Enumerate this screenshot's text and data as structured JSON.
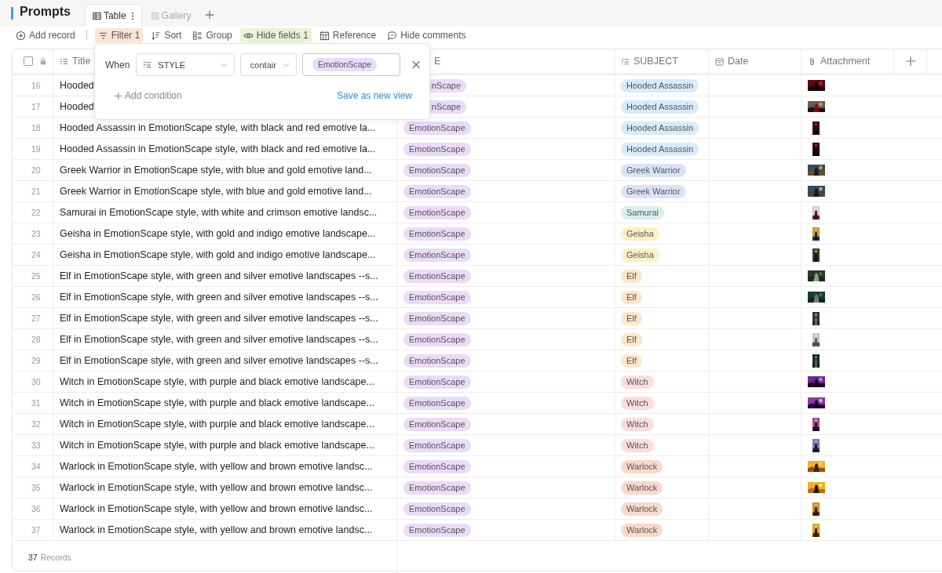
{
  "page": {
    "title": "Prompts"
  },
  "view_tabs": [
    {
      "label": "Table",
      "kind": "table",
      "selected": true
    },
    {
      "label": "Gallery",
      "kind": "gallery",
      "selected": false
    }
  ],
  "toolbar": [
    {
      "label": "Add record",
      "kind": "add",
      "active": false
    },
    {
      "label": "Filter 1",
      "kind": "filter",
      "active": true,
      "color": "#fce4d6"
    },
    {
      "label": "Sort",
      "kind": "sort",
      "active": false
    },
    {
      "label": "Group",
      "kind": "group",
      "active": false
    },
    {
      "label": "Hide fields 1",
      "kind": "eye",
      "active": true,
      "color": "#e8f4d4"
    },
    {
      "label": "Reference",
      "kind": "reference",
      "active": false
    },
    {
      "label": "Hide comments",
      "kind": "comment",
      "active": false
    }
  ],
  "filter_popover": {
    "when": "When",
    "field": "STYLE",
    "operator": "contair",
    "value": "EmotionScape",
    "add_condition": "Add condition",
    "save": "Save as new view"
  },
  "table": {
    "select_all": {
      "checked": false
    },
    "columns": [
      {
        "label": "Title",
        "kind": "text"
      },
      {
        "label": "E",
        "kind": "select"
      },
      {
        "label": "SUBJECT",
        "kind": "select"
      },
      {
        "label": "Date",
        "kind": "date"
      },
      {
        "label": "Attachment",
        "kind": "attachment"
      }
    ],
    "rows": [
      {
        "number": "16",
        "title": "Hooded",
        "style": "nScape",
        "subject": {
          "label": "Hooded Assassin",
          "color": "#d6ebfb"
        }
      },
      {
        "number": "17",
        "title": "Hooded",
        "style": "nScape",
        "subject": {
          "label": "Hooded Assassin",
          "color": "#d6ebfb"
        }
      },
      {
        "number": "18",
        "title": "Hooded Assassin in EmotionScape style, with black and red emotive la...",
        "style": "EmotionScape",
        "subject": {
          "label": "Hooded Assassin",
          "color": "#d6ebfb"
        }
      },
      {
        "number": "19",
        "title": "Hooded Assassin in EmotionScape style, with black and red emotive la...",
        "style": "EmotionScape",
        "subject": {
          "label": "Hooded Assassin",
          "color": "#d6ebfb"
        }
      },
      {
        "number": "20",
        "title": "Greek Warrior in EmotionScape style, with blue and gold emotive land...",
        "style": "EmotionScape",
        "subject": {
          "label": "Greek Warrior",
          "color": "#d9e3f8"
        }
      },
      {
        "number": "21",
        "title": "Greek Warrior in EmotionScape style, with blue and gold emotive land...",
        "style": "EmotionScape",
        "subject": {
          "label": "Greek Warrior",
          "color": "#d9e3f8"
        }
      },
      {
        "number": "22",
        "title": "Samurai in EmotionScape style, with white and crimson emotive landsc...",
        "style": "EmotionScape",
        "subject": {
          "label": "Samurai",
          "color": "#d6f1ee"
        }
      },
      {
        "number": "23",
        "title": "Geisha in EmotionScape style, with gold and indigo emotive landscape...",
        "style": "EmotionScape",
        "subject": {
          "label": "Geisha",
          "color": "#fdf0c2"
        }
      },
      {
        "number": "24",
        "title": "Geisha in EmotionScape style, with gold and indigo emotive landscape...",
        "style": "EmotionScape",
        "subject": {
          "label": "Geisha",
          "color": "#fdf0c2"
        }
      },
      {
        "number": "25",
        "title": "Elf in EmotionScape style, with green and silver emotive landscapes --s...",
        "style": "EmotionScape",
        "subject": {
          "label": "Elf",
          "color": "#fde6c6"
        }
      },
      {
        "number": "26",
        "title": "Elf in EmotionScape style, with green and silver emotive landscapes --s...",
        "style": "EmotionScape",
        "subject": {
          "label": "Elf",
          "color": "#fde6c6"
        }
      },
      {
        "number": "27",
        "title": "Elf in EmotionScape style, with green and silver emotive landscapes --s...",
        "style": "EmotionScape",
        "subject": {
          "label": "Elf",
          "color": "#fde6c6"
        }
      },
      {
        "number": "28",
        "title": "Elf in EmotionScape style, with green and silver emotive landscapes --s...",
        "style": "EmotionScape",
        "subject": {
          "label": "Elf",
          "color": "#fde6c6"
        }
      },
      {
        "number": "29",
        "title": "Elf in EmotionScape style, with green and silver emotive landscapes --s...",
        "style": "EmotionScape",
        "subject": {
          "label": "Elf",
          "color": "#fde6c6"
        }
      },
      {
        "number": "30",
        "title": "Witch in EmotionScape style, with purple and black emotive landscape...",
        "style": "EmotionScape",
        "subject": {
          "label": "Witch",
          "color": "#fbdddd"
        }
      },
      {
        "number": "31",
        "title": "Witch in EmotionScape style, with purple and black emotive landscape...",
        "style": "EmotionScape",
        "subject": {
          "label": "Witch",
          "color": "#fbdddd"
        }
      },
      {
        "number": "32",
        "title": "Witch in EmotionScape style, with purple and black emotive landscape...",
        "style": "EmotionScape",
        "subject": {
          "label": "Witch",
          "color": "#fbdddd"
        }
      },
      {
        "number": "33",
        "title": "Witch in EmotionScape style, with purple and black emotive landscape...",
        "style": "EmotionScape",
        "subject": {
          "label": "Witch",
          "color": "#fbdddd"
        }
      },
      {
        "number": "34",
        "title": "Warlock in EmotionScape style, with yellow and brown emotive landsc...",
        "style": "EmotionScape",
        "subject": {
          "label": "Warlock",
          "color": "#fbd8cb"
        }
      },
      {
        "number": "35",
        "title": "Warlock in EmotionScape style, with yellow and brown emotive landsc...",
        "style": "EmotionScape",
        "subject": {
          "label": "Warlock",
          "color": "#fbd8cb"
        }
      },
      {
        "number": "36",
        "title": "Warlock in EmotionScape style, with yellow and brown emotive landsc...",
        "style": "EmotionScape",
        "subject": {
          "label": "Warlock",
          "color": "#fbd8cb"
        }
      },
      {
        "number": "37",
        "title": "Warlock in EmotionScape style, with yellow and brown emotive landsc...",
        "style": "EmotionScape",
        "subject": {
          "label": "Warlock",
          "color": "#fbd8cb"
        }
      }
    ]
  },
  "footer": {
    "count": "37",
    "label": "Records"
  }
}
